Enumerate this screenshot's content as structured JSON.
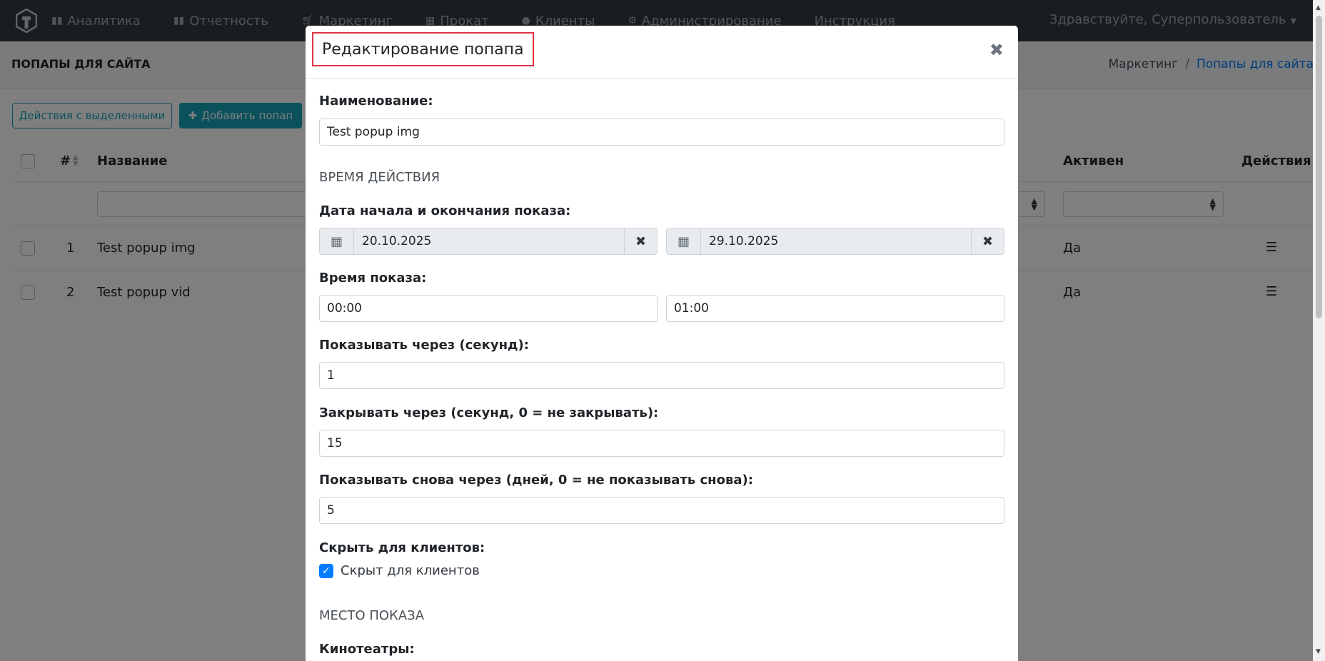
{
  "navbar": {
    "items": [
      {
        "label": "Аналитика",
        "icon": "chart-bar-icon"
      },
      {
        "label": "Отчетность",
        "icon": "chart-bar-icon"
      },
      {
        "label": "Маркетинг",
        "icon": "shopping-cart-icon"
      },
      {
        "label": "Прокат",
        "icon": "film-icon"
      },
      {
        "label": "Клиенты",
        "icon": "user-icon"
      },
      {
        "label": "Администрирование",
        "icon": "cogs-icon"
      },
      {
        "label": "Инструкция",
        "icon": ""
      }
    ],
    "user_greeting": "Здравствуйте, Суперпользователь"
  },
  "page": {
    "title": "ПОПАПЫ ДЛЯ САЙТА",
    "breadcrumb": {
      "parent": "Маркетинг",
      "separator": "/",
      "current": "Попапы для сайта"
    },
    "bulk_actions_label": "Действия с выделенными",
    "add_button_label": "Добавить попап",
    "table": {
      "headers": {
        "number": "#",
        "name": "Название",
        "active": "Активен",
        "actions": "Действия"
      },
      "rows": [
        {
          "number": "1",
          "name": "Test popup img",
          "active": "Да"
        },
        {
          "number": "2",
          "name": "Test popup vid",
          "active": "Да"
        }
      ]
    }
  },
  "modal": {
    "title": "Редактирование попапа",
    "name_label": "Наименование:",
    "name_value": "Test popup img",
    "section_time": "ВРЕМЯ ДЕЙСТВИЯ",
    "dates_label": "Дата начала и окончания показа:",
    "date_start": "20.10.2025",
    "date_end": "29.10.2025",
    "time_label": "Время показа:",
    "time_start": "00:00",
    "time_end": "01:00",
    "show_after_label": "Показывать через (секунд):",
    "show_after_value": "1",
    "close_after_label": "Закрывать через (секунд, 0 = не закрывать):",
    "close_after_value": "15",
    "show_again_label": "Показывать снова через (дней, 0 = не показывать снова):",
    "show_again_value": "5",
    "hide_clients_label": "Скрыть для клиентов:",
    "hide_clients_checkbox_label": "Скрыт для клиентов",
    "hide_clients_checked": true,
    "section_place": "МЕСТО ПОКАЗА",
    "cinemas_label": "Кинотеатры:"
  },
  "colors": {
    "navbar": "#343a40",
    "accent": "#17a2b8",
    "link": "#007bff",
    "title_highlight": "#dc3545"
  }
}
